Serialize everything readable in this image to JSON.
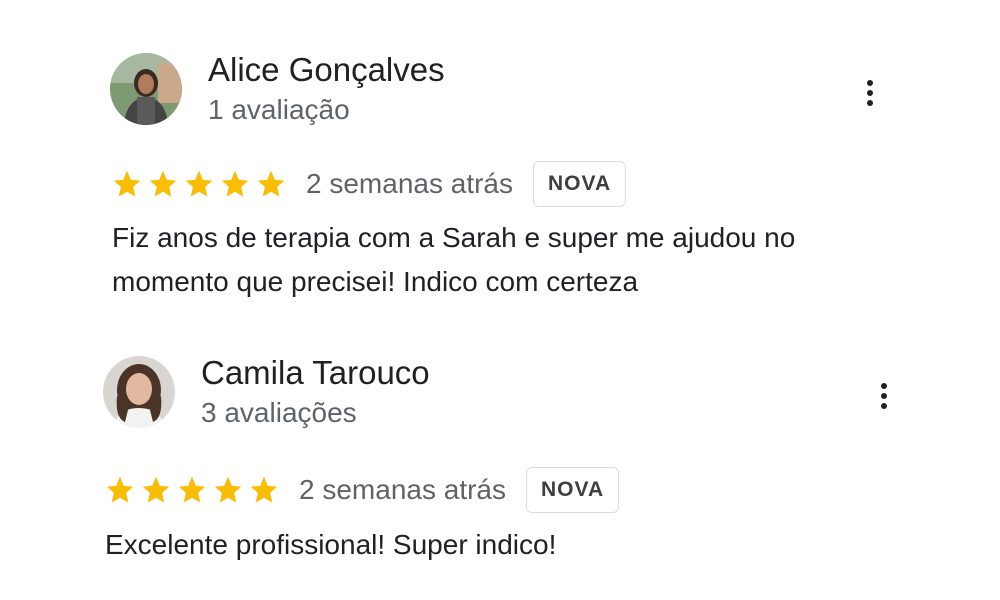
{
  "reviews": [
    {
      "author": "Alice Gonçalves",
      "review_count": "1 avaliação",
      "rating": 5,
      "time": "2 semanas atrás",
      "badge": "NOVA",
      "text": "Fiz anos de terapia com a Sarah e super me ajudou no momento que precisei! Indico com certeza"
    },
    {
      "author": "Camila Tarouco",
      "review_count": "3 avaliações",
      "rating": 5,
      "time": "2 semanas atrás",
      "badge": "NOVA",
      "text": "Excelente profissional! Super indico!"
    }
  ],
  "colors": {
    "star": "#fbbc04",
    "muted_text": "#5f6368",
    "primary_text": "#202124",
    "badge_border": "#dadce0"
  },
  "icons": {
    "star": "star-icon",
    "more": "more-vert-icon"
  }
}
